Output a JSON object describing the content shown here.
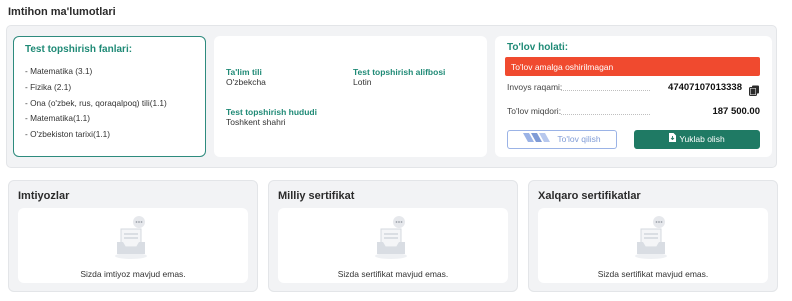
{
  "section_title": "Imtihon ma'lumotlari",
  "subjects": {
    "title": "Test topshirish fanlari:",
    "items": [
      "- Matematika (3.1)",
      "- Fizika (2.1)",
      "- Ona (o'zbek, rus, qoraqalpoq) tili(1.1)",
      "- Matematika(1.1)",
      "- O'zbekiston tarixi(1.1)"
    ]
  },
  "info": {
    "language_label": "Ta'lim tili",
    "language_value": "O'zbekcha",
    "alphabet_label": "Test topshirish alifbosi",
    "alphabet_value": "Lotin",
    "region_label": "Test topshirish hududi",
    "region_value": "Toshkent shahri"
  },
  "payment": {
    "title": "To'lov holati:",
    "status": "To'lov amalga oshirilmagan",
    "status_color": "#f04a2f",
    "invoice_label": "Invoys raqami:",
    "invoice_value": "47407107013338",
    "amount_label": "To'lov miqdori:",
    "amount_value": "187 500.00",
    "pay_button": "To'lov qilish",
    "download_button": "Yuklab olish",
    "accent_color": "#1f7a64"
  },
  "cards": [
    {
      "title": "Imtiyozlar",
      "empty_text": "Sizda imtiyoz mavjud emas."
    },
    {
      "title": "Milliy sertifikat",
      "empty_text": "Sizda sertifikat mavjud emas."
    },
    {
      "title": "Xalqaro sertifikatlar",
      "empty_text": "Sizda sertifikat mavjud emas."
    }
  ]
}
